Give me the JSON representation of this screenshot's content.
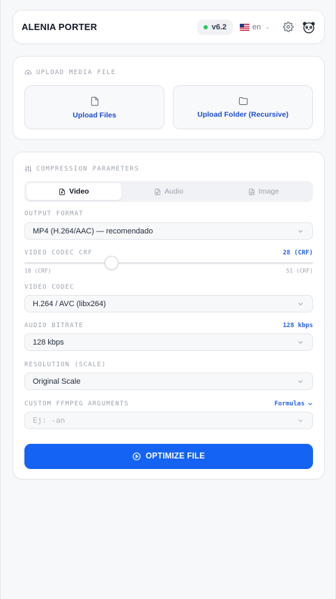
{
  "header": {
    "brand": "ALENIA PORTER",
    "version": "v6.2",
    "language": "en",
    "status_color": "#22c55e"
  },
  "upload": {
    "title": "UPLOAD MEDIA FILE",
    "files_label": "Upload Files",
    "folder_label": "Upload Folder (Recursive)"
  },
  "compression": {
    "title": "COMPRESSION PARAMETERS",
    "tabs": [
      {
        "label": "Video",
        "active": true
      },
      {
        "label": "Audio",
        "active": false
      },
      {
        "label": "Image",
        "active": false
      }
    ],
    "output_format": {
      "label": "OUTPUT FORMAT",
      "value": "MP4 (H.264/AAC) — recomendado"
    },
    "crf": {
      "label": "VIDEO CODEC CRF",
      "value_text": "28 (CRF)",
      "min_text": "18 (CRF)",
      "max_text": "51 (CRF)",
      "min": 18,
      "max": 51,
      "value": 28
    },
    "video_codec": {
      "label": "VIDEO CODEC",
      "value": "H.264 / AVC (libx264)"
    },
    "audio_bitrate": {
      "label": "AUDIO BITRATE",
      "value_text": "128 kbps",
      "value": "128 kbps"
    },
    "resolution": {
      "label": "RESOLUTION (SCALE)",
      "value": "Original Scale"
    },
    "custom_args": {
      "label": "CUSTOM FFMPEG ARGUMENTS",
      "formulas_label": "Formulas",
      "placeholder": "Ej: -an"
    },
    "optimize_label": "OPTIMIZE FILE"
  },
  "colors": {
    "accent": "#1463f3",
    "link": "#2563eb"
  }
}
